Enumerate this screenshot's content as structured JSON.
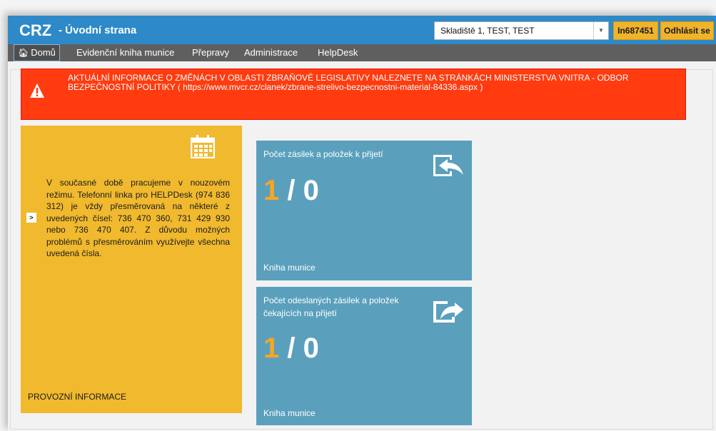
{
  "header": {
    "app_name": "CRZ",
    "page_title": "- Úvodní strana",
    "warehouse_select": "Skladiště 1, TEST, TEST",
    "user_id": "In687451",
    "logout_label": "Odhlásit se"
  },
  "nav": {
    "items": [
      {
        "label": "Domů",
        "icon": "home-icon"
      },
      {
        "label": "Evidenční kniha munice"
      },
      {
        "label": "Přepravy"
      },
      {
        "label": "Administrace"
      },
      {
        "label": "HelpDesk"
      }
    ]
  },
  "alert": {
    "icon": "warning-icon",
    "text": "AKTUÁLNÍ INFORMACE O ZMĚNÁCH V OBLASTI ZBRAŇOVÉ LEGISLATIVY NALEZNETE NA STRÁNKÁCH MINISTERSTVA VNITRA - ODBOR BEZPEČNOSTNÍ POLITIKY ( https://www.mvcr.cz/clanek/zbrane-strelivo-bezpecnostni-material-84336.aspx )"
  },
  "info_tile": {
    "icon": "calendar-icon",
    "text": "V současné době pracujeme v nouzovém režimu. Telefonní linka pro HELPDesk (974 836 312) je vždy přesměrovaná na některé z uvedených čísel: 736 470 360, 731 429 930 nebo 736 470 407. Z důvodu možných problémů s přesměrováním využívejte všechna uvedená čísla.",
    "footer": "PROVOZNÍ INFORMACE"
  },
  "receive_tile": {
    "title": "Počet zásilek a položek k přijetí",
    "count_a": "1",
    "count_sep": " / ",
    "count_b": "0",
    "footer": "Kniha munice",
    "icon": "sign-in-icon"
  },
  "sent_tile": {
    "title": "Počet odeslaných zásilek a položek čekajících na přijetí",
    "count_a": "1",
    "count_sep": " / ",
    "count_b": "0",
    "footer": "Kniha munice",
    "icon": "share-icon"
  },
  "colors": {
    "titlebar": "#2d89c8",
    "nav": "#5f5f5f",
    "alert": "#ff3b0f",
    "info_tile": "#f0b92e",
    "stat_tile": "#5aa0bd",
    "count_accent": "#f6a623"
  }
}
